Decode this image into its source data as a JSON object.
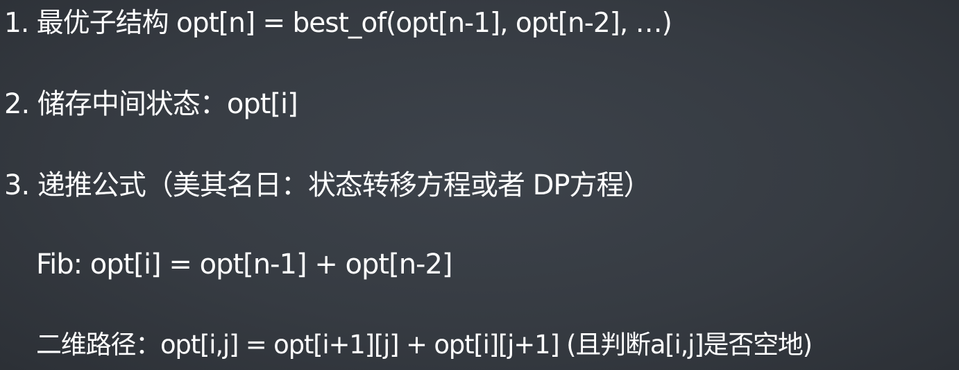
{
  "slide": {
    "lines": [
      {
        "text": "1. 最优子结构  opt[n] = best_of(opt[n-1], opt[n-2], …)"
      },
      {
        "text": "2. 储存中间状态：opt[i]"
      },
      {
        "text": "3. 递推公式（美其名日：状态转移方程或者 DP方程）"
      },
      {
        "text": "Fib: opt[i] = opt[n-1] + opt[n-2]"
      },
      {
        "text": "二维路径：opt[i,j] = opt[i+1][j] + opt[i][j+1] (且判断a[i,j]是否空地)"
      }
    ]
  }
}
